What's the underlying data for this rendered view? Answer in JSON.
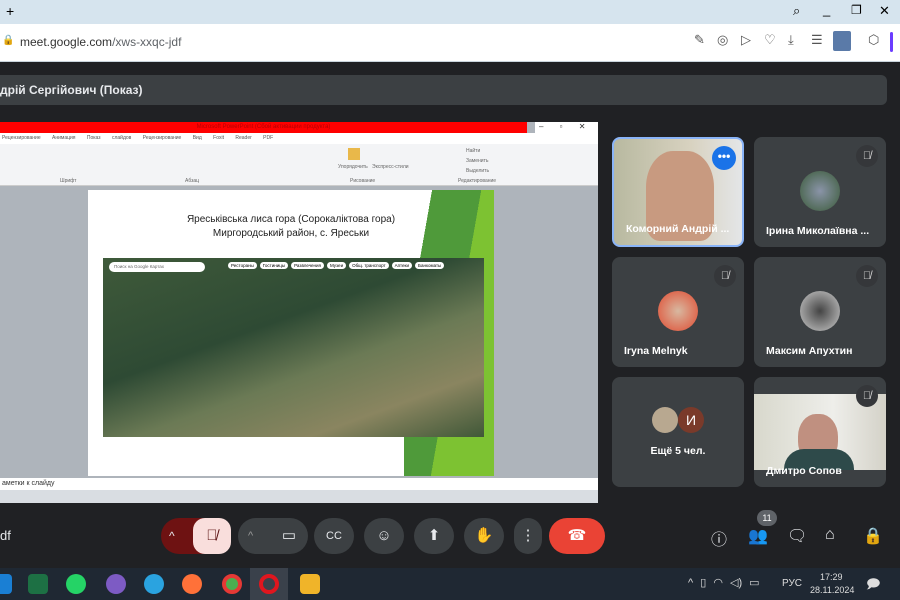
{
  "browser": {
    "new_tab": "+",
    "url_host": "meet.google.com",
    "url_path": "/xws-xxqc-jdf"
  },
  "meet": {
    "presenter_title": "дрій Сергійович (Показ)",
    "meeting_code_fragment": "df",
    "participants_count": "11",
    "tiles": [
      {
        "name": "Коморний Андрій ...",
        "muted": false,
        "video": true
      },
      {
        "name": "Ірина Миколаївна ...",
        "muted": true
      },
      {
        "name": "Iryna Melnyk",
        "muted": true
      },
      {
        "name": "Максим Апухтин",
        "muted": true
      },
      {
        "name": "Ещё 5 чел.",
        "initial": "И"
      },
      {
        "name": "Дмитро Сопов",
        "muted": true,
        "video": true
      }
    ],
    "colors": {
      "end_call": "#ea4335",
      "mic_off_bg": "#f9dedc",
      "accent": "#8ab4f8"
    }
  },
  "ppt": {
    "window_title": "Microsoft PowerPoint (Сбой активации продукта)",
    "menu": [
      "Рецензирование",
      "Анимация",
      "Показ слайдов",
      "Рецензирование",
      "Вид",
      "Foxit Reader PDF"
    ],
    "ribbon_groups": [
      "Шрифт",
      "Абзац",
      "Рисование",
      "Редактирование"
    ],
    "ribbon_items": [
      "Упорядочить",
      "Экспресс-стили",
      "Найти",
      "Заменить",
      "Выделить"
    ],
    "slide_title_line1": "Яреськівська лиса гора (Сорокаліктова гора)",
    "slide_title_line2": "Миргородський район, с. Яреськи",
    "map_search_placeholder": "Поиск на Google Картах",
    "map_chips": [
      "Рестораны",
      "Гостиницы",
      "Развлечения",
      "Музеи",
      "Общ. транспорт",
      "Аптеки",
      "Банкоматы"
    ],
    "notes": "аметки к слайду"
  },
  "taskbar": {
    "lang": "РУС",
    "time": "17:29",
    "date": "28.11.2024"
  }
}
